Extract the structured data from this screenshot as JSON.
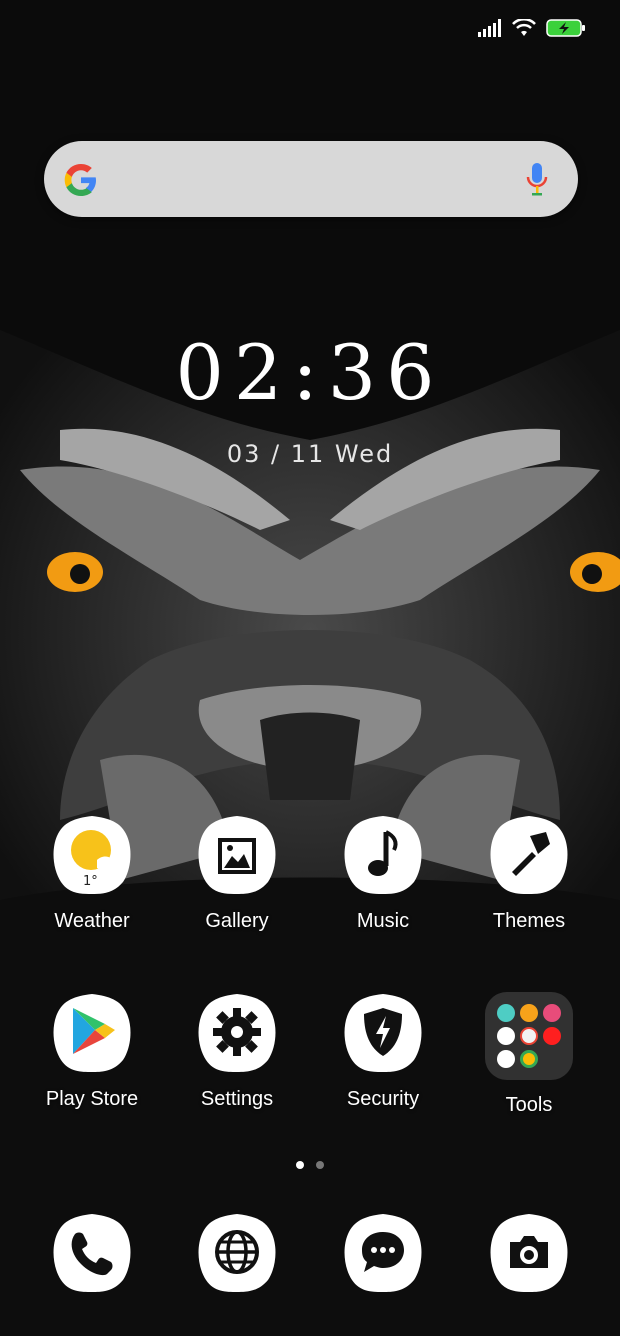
{
  "status_bar": {
    "signal_icon": "signal-icon",
    "wifi_icon": "wifi-icon",
    "battery_icon": "battery-charging-icon"
  },
  "search": {
    "logo_icon": "google-logo-icon",
    "mic_icon": "mic-icon"
  },
  "clock": {
    "time": "02:36",
    "date": "03 / 11 Wed"
  },
  "apps_row1": [
    {
      "label": "Weather",
      "icon": "weather-icon",
      "temp": "1°"
    },
    {
      "label": "Gallery",
      "icon": "gallery-icon"
    },
    {
      "label": "Music",
      "icon": "music-note-icon"
    },
    {
      "label": "Themes",
      "icon": "paintbrush-icon"
    }
  ],
  "apps_row2": [
    {
      "label": "Play Store",
      "icon": "play-store-icon"
    },
    {
      "label": "Settings",
      "icon": "gear-icon"
    },
    {
      "label": "Security",
      "icon": "shield-bolt-icon"
    },
    {
      "label": "Tools",
      "icon": "folder-icon"
    }
  ],
  "page_indicator": {
    "pages": 2,
    "current": 1
  },
  "dock": [
    {
      "icon": "phone-icon"
    },
    {
      "icon": "browser-globe-icon"
    },
    {
      "icon": "messaging-icon"
    },
    {
      "icon": "camera-icon"
    }
  ],
  "colors": {
    "background": "#0a0a0a",
    "search_bg": "#d8d8d8",
    "eye": "#f29b12"
  }
}
